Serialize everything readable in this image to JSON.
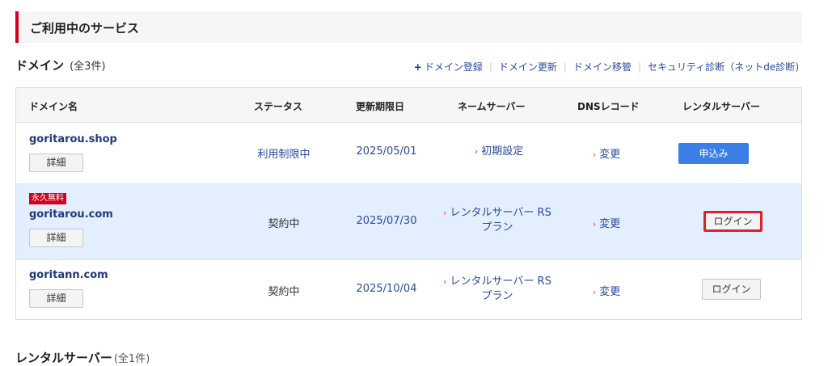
{
  "section": {
    "title": "ご利用中のサービス"
  },
  "domains": {
    "title": "ドメイン",
    "count": "(全3件)",
    "links": {
      "plus": "+",
      "register": "ドメイン登録",
      "renew": "ドメイン更新",
      "transfer": "ドメイン移管",
      "security": "セキュリティ診断（ネットde診断)"
    }
  },
  "table": {
    "headers": {
      "domain": "ドメイン名",
      "status": "ステータス",
      "expiry": "更新期限日",
      "nameserver": "ネームサーバー",
      "dns": "DNSレコード",
      "rental": "レンタルサーバー"
    },
    "rows": [
      {
        "badge": "",
        "domain": "goritarou.shop",
        "detail": "詳細",
        "status": "利用制限中",
        "expiry": "2025/05/01",
        "nameserver_line1": "初期設定",
        "nameserver_line2": "",
        "dns": "変更",
        "rental": "申込み"
      },
      {
        "badge": "永久無料",
        "domain": "goritarou.com",
        "detail": "詳細",
        "status": "契約中",
        "expiry": "2025/07/30",
        "nameserver_line1": "レンタルサーバー RS",
        "nameserver_line2": "プラン",
        "dns": "変更",
        "rental": "ログイン"
      },
      {
        "badge": "",
        "domain": "goritann.com",
        "detail": "詳細",
        "status": "契約中",
        "expiry": "2025/10/04",
        "nameserver_line1": "レンタルサーバー RS",
        "nameserver_line2": "プラン",
        "dns": "変更",
        "rental": "ログイン"
      }
    ]
  },
  "arrow_glyph": "›",
  "rental": {
    "title": "レンタルサーバー",
    "count": "(全1件)"
  },
  "colors": {
    "accent_red": "#d6001c",
    "link_blue": "#2a4a9c",
    "button_blue": "#3a7ee6",
    "highlight_row": "#e3efff"
  }
}
